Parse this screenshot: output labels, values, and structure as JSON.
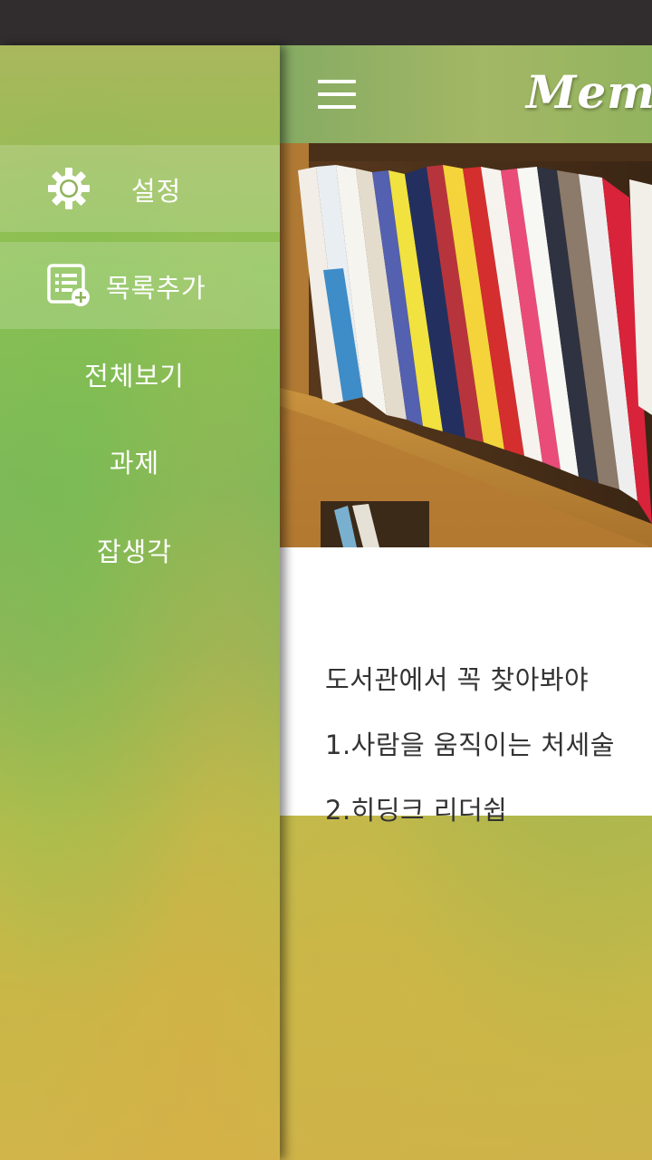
{
  "app": {
    "title": "Memgr"
  },
  "drawer": {
    "settings_label": "설정",
    "add_list_label": "목록추가",
    "nav_items": [
      {
        "label": "전체보기"
      },
      {
        "label": "과제"
      },
      {
        "label": "잡생각"
      }
    ]
  },
  "memo": {
    "lines": [
      "도서관에서 꼭 찾아봐야",
      "1.사람을 움직이는 처세술",
      "2.히딩크 리더쉽"
    ]
  },
  "colors": {
    "status_bar": "#312d2e",
    "drawer_green": "#8cc152",
    "card_bg": "#ffffff",
    "text_dark": "#333333"
  },
  "icons": {
    "settings": "gear-icon",
    "add_list": "list-add-icon",
    "menu": "hamburger-menu-icon"
  }
}
